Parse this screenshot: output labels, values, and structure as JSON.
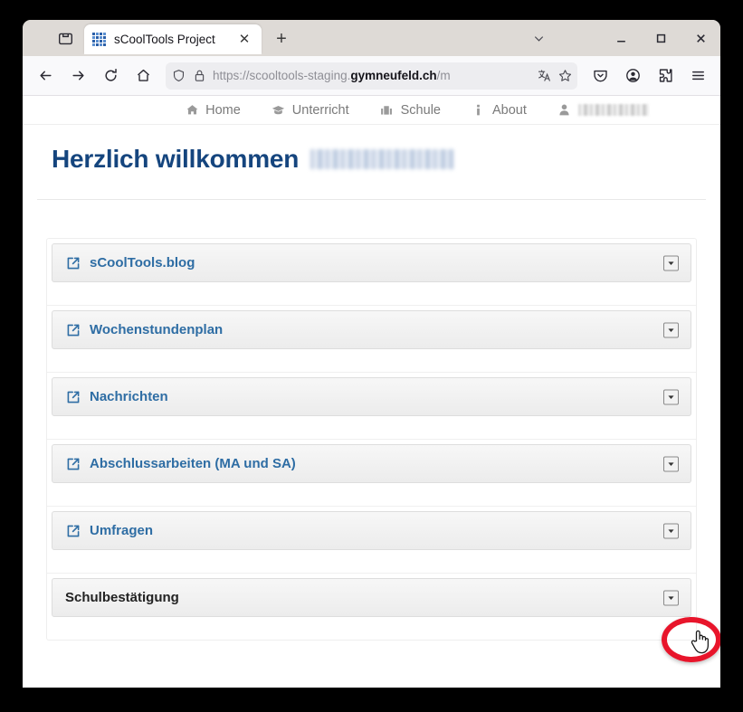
{
  "browser": {
    "window_controls": {
      "list_all_tabs": "chevron-down",
      "minimize": "minimize",
      "maximize": "maximize",
      "close": "close"
    },
    "tab_list_button": "tab-list",
    "tabs": [
      {
        "title": "sCoolTools Project",
        "favicon": "grid-squares-favicon",
        "close_label": "✕",
        "active": true
      }
    ],
    "new_tab_label": "+",
    "toolbar": {
      "back": "back-arrow",
      "forward": "forward-arrow",
      "reload": "reload",
      "home": "home",
      "shield": "shield",
      "lock": "padlock",
      "url_prefix": "https://scooltools-staging.",
      "url_domain": "gymneufeld.ch",
      "url_suffix": "/m",
      "translate": "translate",
      "bookmark": "star-outline",
      "pocket": "pocket-save",
      "account": "account-circle",
      "extensions": "puzzle-piece",
      "app_menu": "hamburger-menu"
    }
  },
  "site_nav": {
    "items": [
      {
        "label": "Home",
        "icon": "home-icon"
      },
      {
        "label": "Unterricht",
        "icon": "graduation-cap-icon"
      },
      {
        "label": "Schule",
        "icon": "school-building-icon"
      },
      {
        "label": "About",
        "icon": "info-icon"
      }
    ],
    "user": {
      "icon": "person-icon",
      "name_redacted": true
    }
  },
  "page": {
    "welcome_heading": "Herzlich willkommen",
    "user_name_redacted": true,
    "panels": [
      {
        "title": "sCoolTools.blog",
        "has_external_link": true,
        "toggle_icon": "caret-down-box",
        "expanded": false
      },
      {
        "title": "Wochenstundenplan",
        "has_external_link": true,
        "toggle_icon": "caret-down-box",
        "expanded": false
      },
      {
        "title": "Nachrichten",
        "has_external_link": true,
        "toggle_icon": "caret-down-box",
        "expanded": false
      },
      {
        "title": "Abschlussarbeiten (MA und SA)",
        "has_external_link": true,
        "toggle_icon": "caret-down-box",
        "expanded": false
      },
      {
        "title": "Umfragen",
        "has_external_link": true,
        "toggle_icon": "caret-down-box",
        "expanded": false
      },
      {
        "title": "Schulbestätigung",
        "has_external_link": false,
        "toggle_icon": "caret-down-box",
        "expanded": false
      }
    ]
  },
  "annotation": {
    "type": "click-target-highlight",
    "color": "#e8152b",
    "target": "Schulbestätigung panel toggle button",
    "cursor": "pointing-hand-cursor"
  },
  "colors": {
    "link_blue": "#2e6da4",
    "heading_blue": "#15457e",
    "annotation_red": "#e8152b",
    "chrome_bg": "#dedad6",
    "toolbar_bg": "#f9f9fb"
  }
}
